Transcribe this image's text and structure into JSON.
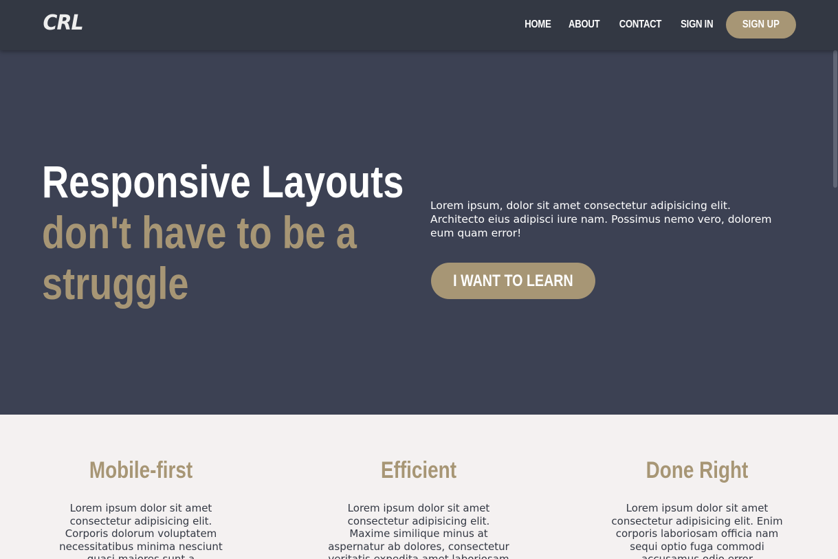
{
  "header": {
    "logo": "CRL",
    "nav": [
      "HOME",
      "ABOUT",
      "CONTACT",
      "SIGN IN"
    ],
    "signup_label": "SIGN UP"
  },
  "hero": {
    "title_line1": "Responsive Layouts",
    "title_line2": "don't have to be a struggle",
    "text": "Lorem ipsum, dolor sit amet consectetur adipisicing elit. Architecto eius adipisci iure nam. Possimus nemo vero, dolorem eum quam error!",
    "cta_label": "I WANT TO LEARN"
  },
  "features": [
    {
      "title": "Mobile-first",
      "text": "Lorem ipsum dolor sit amet consectetur adipisicing elit. Corporis dolorum voluptatem necessitatibus minima nesciunt quasi maiores sunt a"
    },
    {
      "title": "Efficient",
      "text": "Lorem ipsum dolor sit amet consectetur adipisicing elit. Maxime similique minus at aspernatur ab dolores, consectetur veritatis expedita amet laboriosam"
    },
    {
      "title": "Done Right",
      "text": "Lorem ipsum dolor sit amet consectetur adipisicing elit. Enim corporis laboriosam officia nam sequi optio fuga commodi accusamus odio error"
    }
  ],
  "colors": {
    "header_bg": "#333843",
    "hero_bg": "#3c4153",
    "accent": "#a79675",
    "page_bg": "#f4f1f1"
  }
}
